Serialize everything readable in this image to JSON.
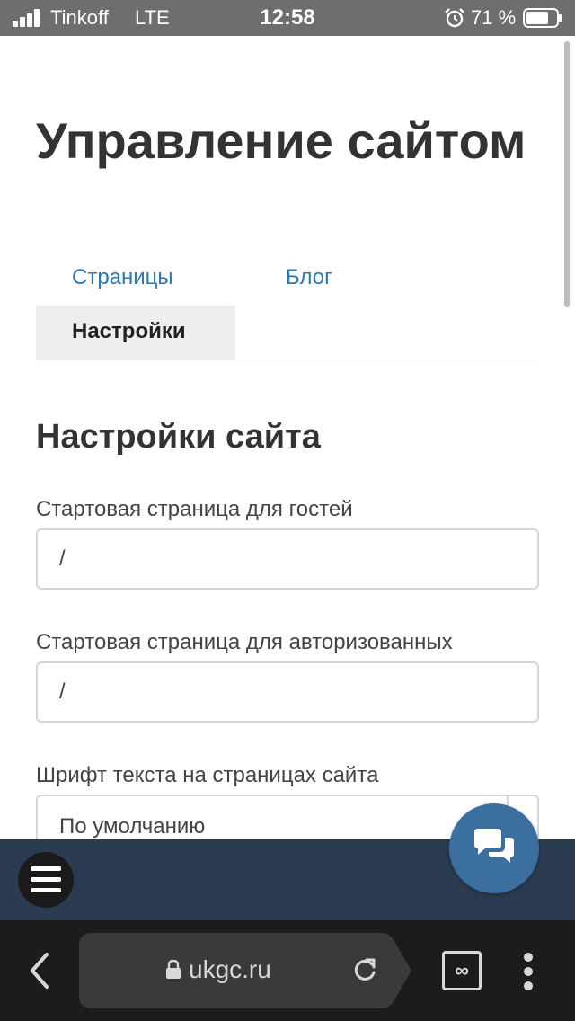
{
  "status_bar": {
    "carrier": "Tinkoff",
    "network": "LTE",
    "time": "12:58",
    "battery_percent": "71 %",
    "icons": [
      "signal-icon",
      "alarm-icon",
      "battery-icon"
    ]
  },
  "page": {
    "title": "Управление сайтом",
    "tabs": [
      {
        "label": "Страницы",
        "active": false
      },
      {
        "label": "Блог",
        "active": false
      },
      {
        "label": "Настройки",
        "active": true
      }
    ],
    "section_title": "Настройки сайта",
    "fields": {
      "guest_start": {
        "label": "Стартовая страница для гостей",
        "value": "/"
      },
      "auth_start": {
        "label": "Стартовая страница для авторизованных",
        "value": "/"
      },
      "font": {
        "label": "Шрифт текста на страницах сайта",
        "value": "По умолчанию"
      }
    }
  },
  "site_bar": {
    "menu_icon": "hamburger-icon",
    "chat_icon": "chat-bubbles-icon"
  },
  "browser": {
    "url": "ukgc.ru",
    "tabs_label": "∞",
    "icons": [
      "back-icon",
      "lock-icon",
      "reload-icon",
      "more-icon"
    ]
  },
  "colors": {
    "status_bar": "#6e6e6e",
    "link": "#2a7ab0",
    "site_bar": "#2b3c52",
    "chat_button": "#3b6fa0",
    "browser_bar": "#1c1c1e"
  }
}
